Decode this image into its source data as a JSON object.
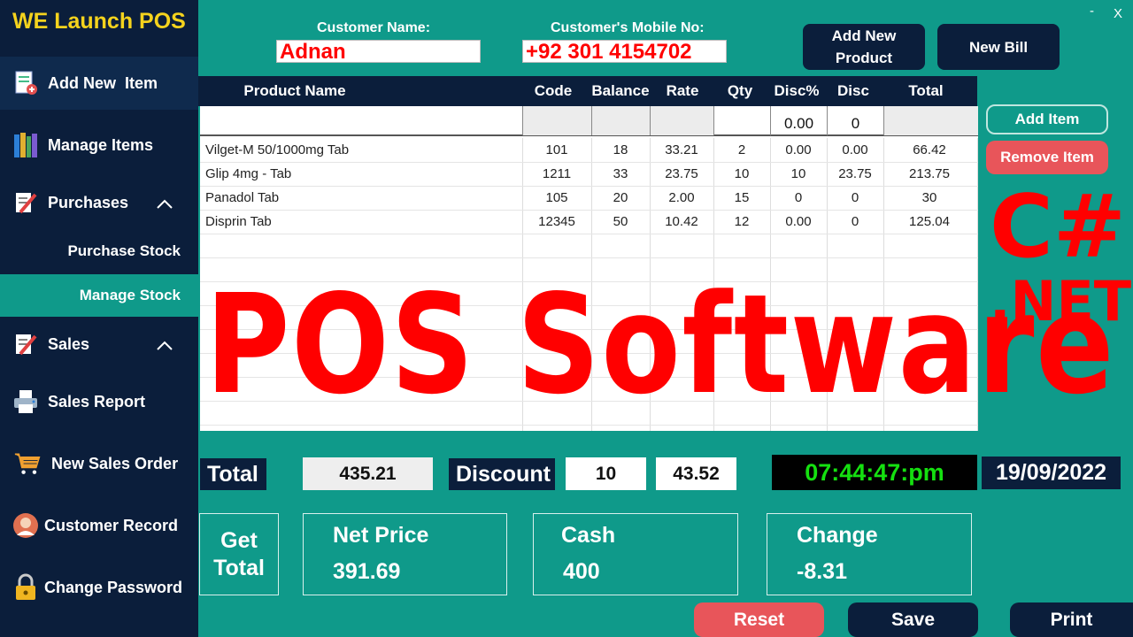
{
  "app": {
    "title": "WE Launch POS",
    "window_close": "X",
    "window_minimize": "-"
  },
  "sidebar": {
    "items": [
      {
        "label": "Add New  Item",
        "icon": "add-document-icon"
      },
      {
        "label": "Manage Items",
        "icon": "books-icon"
      },
      {
        "label": "Purchases",
        "icon": "edit-form-icon"
      },
      {
        "label": "Purchase Stock"
      },
      {
        "label": "Manage Stock"
      },
      {
        "label": "Sales",
        "icon": "edit-form-icon"
      },
      {
        "label": "Sales Report",
        "icon": "printer-icon"
      },
      {
        "label": "New Sales Order",
        "icon": "shopping-cart-icon"
      },
      {
        "label": "Customer Record",
        "icon": "user-icon"
      },
      {
        "label": "Change Password",
        "icon": "lock-icon"
      }
    ]
  },
  "customer": {
    "name_label": "Customer Name:",
    "name_value": "Adnan",
    "mobile_label": "Customer's Mobile No:",
    "mobile_value": "+92 301 4154702"
  },
  "header_buttons": {
    "add_new_product": "Add New Product",
    "new_bill": "New Bill"
  },
  "table": {
    "columns": [
      "Product Name",
      "Code",
      "Balance",
      "Rate",
      "Qty",
      "Disc%",
      "Disc",
      "Total"
    ],
    "entry": {
      "disc_pct": "0.00",
      "disc": "0"
    },
    "rows": [
      [
        "Vilget-M 50/1000mg Tab",
        "101",
        "18",
        "33.21",
        "2",
        "0.00",
        "0.00",
        "66.42"
      ],
      [
        "Glip 4mg - Tab",
        "1211",
        "33",
        "23.75",
        "10",
        "10",
        "23.75",
        "213.75"
      ],
      [
        "Panadol Tab",
        "105",
        "20",
        "2.00",
        "15",
        "0",
        "0",
        "30"
      ],
      [
        "Disprin Tab",
        "12345",
        "50",
        "10.42",
        "12",
        "0.00",
        "0",
        "125.04"
      ]
    ]
  },
  "actions": {
    "add_item": "Add Item",
    "remove_item": "Remove Item"
  },
  "overlay": {
    "headline": "POS Software",
    "lang_top": "C#",
    "lang_bottom": ".NET"
  },
  "totals": {
    "total_label": "Total",
    "total_value": "435.21",
    "discount_label": "Discount",
    "discount_pct": "10",
    "discount_amount": "43.52",
    "time": "07:44:47:pm",
    "date": "19/09/2022"
  },
  "summary": {
    "get_total": "Get Total",
    "net_price_label": "Net Price",
    "net_price_value": "391.69",
    "cash_label": "Cash",
    "cash_value": "400",
    "change_label": "Change",
    "change_value": "-8.31"
  },
  "footer_buttons": {
    "reset": "Reset",
    "save": "Save",
    "print": "Print"
  },
  "colors": {
    "accent": "#0f9a8a",
    "navy": "#0b1e3b",
    "brand": "#f5d31d",
    "danger": "#e8555a",
    "overlay": "#ff0000",
    "clock": "#15e010"
  }
}
